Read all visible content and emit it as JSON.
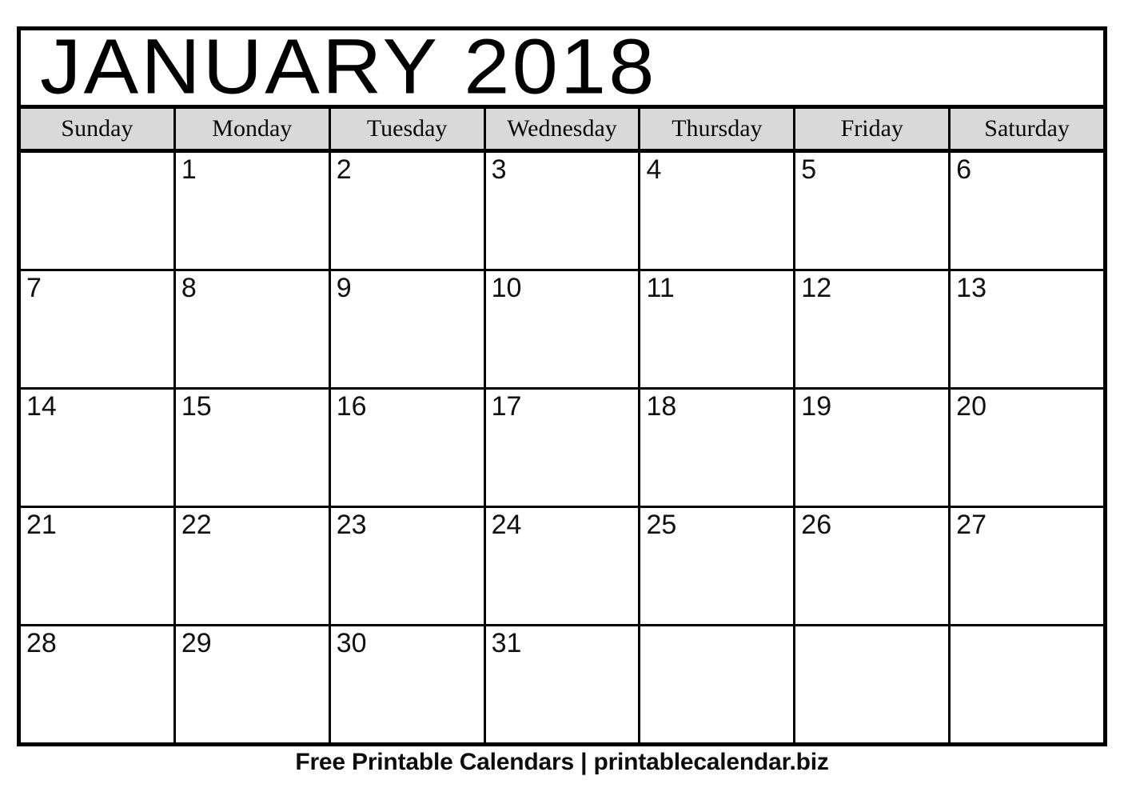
{
  "calendar": {
    "title": "JANUARY 2018",
    "month": "January",
    "year": "2018",
    "header_bg": "#d9d9d9",
    "border_color": "#000000",
    "weekdays": [
      {
        "label": "Sunday"
      },
      {
        "label": "Monday"
      },
      {
        "label": "Tuesday"
      },
      {
        "label": "Wednesday"
      },
      {
        "label": "Thursday"
      },
      {
        "label": "Friday"
      },
      {
        "label": "Saturday"
      }
    ],
    "weeks": [
      [
        {
          "day": ""
        },
        {
          "day": "1"
        },
        {
          "day": "2"
        },
        {
          "day": "3"
        },
        {
          "day": "4"
        },
        {
          "day": "5"
        },
        {
          "day": "6"
        }
      ],
      [
        {
          "day": "7"
        },
        {
          "day": "8"
        },
        {
          "day": "9"
        },
        {
          "day": "10"
        },
        {
          "day": "11"
        },
        {
          "day": "12"
        },
        {
          "day": "13"
        }
      ],
      [
        {
          "day": "14"
        },
        {
          "day": "15"
        },
        {
          "day": "16"
        },
        {
          "day": "17"
        },
        {
          "day": "18"
        },
        {
          "day": "19"
        },
        {
          "day": "20"
        }
      ],
      [
        {
          "day": "21"
        },
        {
          "day": "22"
        },
        {
          "day": "23"
        },
        {
          "day": "24"
        },
        {
          "day": "25"
        },
        {
          "day": "26"
        },
        {
          "day": "27"
        }
      ],
      [
        {
          "day": "28"
        },
        {
          "day": "29"
        },
        {
          "day": "30"
        },
        {
          "day": "31"
        },
        {
          "day": ""
        },
        {
          "day": ""
        },
        {
          "day": ""
        }
      ]
    ]
  },
  "footer": {
    "text": "Free Printable Calendars | printablecalendar.biz",
    "site_name": "printablecalendar.biz",
    "tagline": "Free Printable Calendars"
  }
}
